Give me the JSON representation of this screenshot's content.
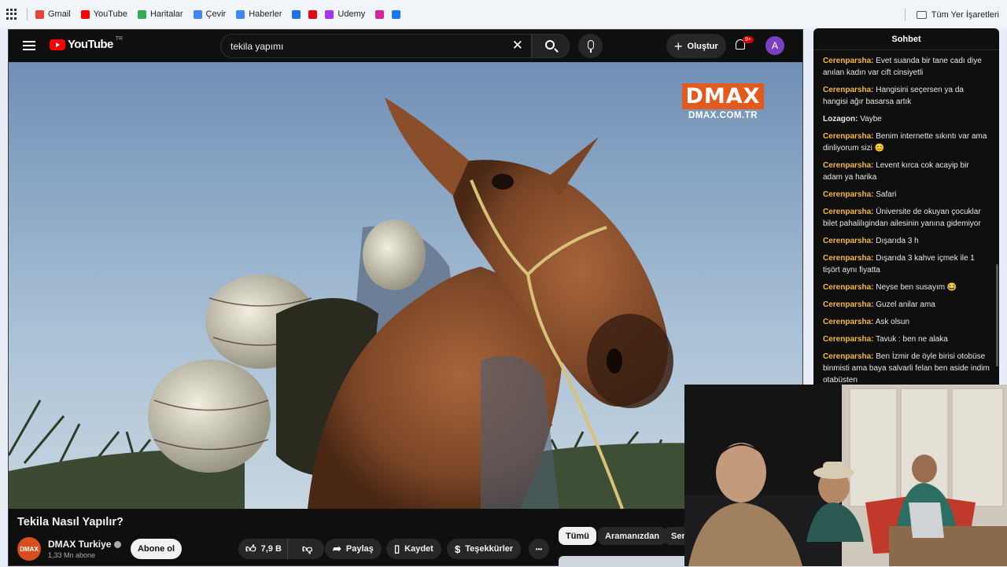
{
  "bookmarks": {
    "items": [
      {
        "label": "Gmail",
        "color": "#ea4335"
      },
      {
        "label": "YouTube",
        "color": "#ff0000"
      },
      {
        "label": "Haritalar",
        "color": "#34a853"
      },
      {
        "label": "Çevir",
        "color": "#4285f4"
      },
      {
        "label": "Haberler",
        "color": "#4285f4"
      },
      {
        "label": "",
        "color": "#1a73e8"
      },
      {
        "label": "",
        "color": "#e50914"
      },
      {
        "label": "Udemy",
        "color": "#a435f0"
      },
      {
        "label": "",
        "color": "#d6249f"
      },
      {
        "label": "",
        "color": "#1877f2"
      }
    ],
    "all_bookmarks": "Tüm Yer İşaretleri"
  },
  "youtube": {
    "logo_text": "YouTube",
    "region": "TR",
    "search_value": "tekila yapımı",
    "create_label": "Oluştur",
    "notif_badge": "9+",
    "avatar_letter": "A"
  },
  "video": {
    "watermark": "DMAX",
    "watermark_url": "DMAX.COM.TR",
    "title": "Tekila Nasıl Yapılır?",
    "channel": "DMAX Turkiye",
    "channel_avatar_text": "DMAX",
    "subscribers": "1,33 Mn abone",
    "subscribe_label": "Abone ol",
    "likes": "7,9 B",
    "share_label": "Paylaş",
    "save_label": "Kaydet",
    "thanks_label": "Teşekkürler",
    "more_label": "•••"
  },
  "chips": [
    "Tümü",
    "Aramanızdan",
    "Ser"
  ],
  "chat": {
    "title": "Sohbet",
    "messages": [
      {
        "user": "Cerenparsha:",
        "text": "Evet suanda bir tane cadı diye anılan kadın var cift cinsiyetli"
      },
      {
        "user": "Cerenparsha:",
        "text": "Hangisini seçersen ya da hangisi ağır basarsa artık"
      },
      {
        "user": "Lozagon:",
        "text": "Vaybe"
      },
      {
        "user": "Cerenparsha:",
        "text": "Benim internette sıkıntı var ama dinliyorum sizi 😊"
      },
      {
        "user": "Cerenparsha:",
        "text": "Levent kırca cok acayip bir adam ya harika"
      },
      {
        "user": "Cerenparsha:",
        "text": "Safari"
      },
      {
        "user": "Cerenparsha:",
        "text": "Üniversite de okuyan çocuklar bilet pahalilıgindan ailesinin yanına gidemiyor"
      },
      {
        "user": "Cerenparsha:",
        "text": "Dışarıda 3 h"
      },
      {
        "user": "Cerenparsha:",
        "text": "Dışarıda 3 kahve içmek ile 1 tişört aynı fiyatta"
      },
      {
        "user": "Cerenparsha:",
        "text": "Neyse ben susayım 😂"
      },
      {
        "user": "Cerenparsha:",
        "text": "Guzel anilar ama"
      },
      {
        "user": "Cerenparsha:",
        "text": "Ask olsun"
      },
      {
        "user": "Cerenparsha:",
        "text": "Tavuk : ben ne alaka"
      },
      {
        "user": "Cerenparsha:",
        "text": "Ben İzmir de öyle birisi otobüse binmisti ama baya salvarli felan ben aside indim otabüsten"
      }
    ]
  }
}
